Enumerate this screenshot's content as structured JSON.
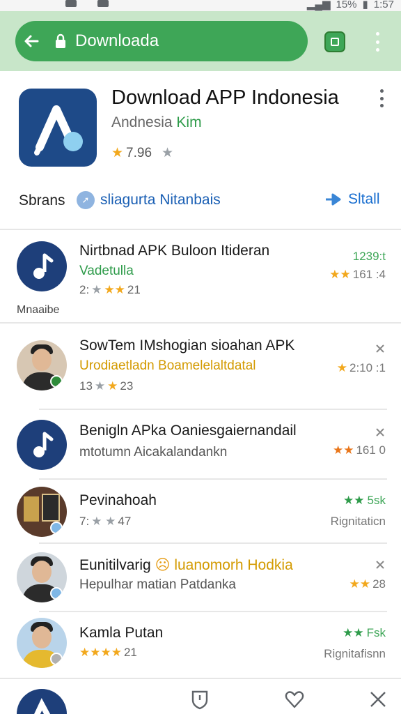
{
  "status": {
    "battery": "15%",
    "time": "1:57"
  },
  "browser": {
    "url": "Downloada"
  },
  "app": {
    "title": "Download APP Indonesia",
    "subtitle_main": "Andnesia",
    "subtitle_tag": "Kim",
    "rating": "7.96",
    "shares_label": "Sbrans",
    "share_link": "sliagurta  Nitanbais",
    "install_label": "Sltall"
  },
  "items": [
    {
      "title": "Nirtbnad APK Buloon Itideran",
      "subtitle": "Vadetulla",
      "meta": "2: ★ ★★ 21",
      "meta_prefix": "2:",
      "meta_count": "21",
      "right_top": "1239:t",
      "right_bottom": "161 :4",
      "footer": "Mnaaibe"
    },
    {
      "title": "SowTem IMshogian sioahan APK",
      "subtitle": "Urodiaetladn  Boamelelaltdatal",
      "meta_prefix": "13",
      "meta_count": "23",
      "right_bottom": "2:10 :1"
    },
    {
      "title": "Benigln APka Oaniesgaiernandail",
      "subtitle": "mtotumn Aicakalandankn",
      "right_bottom": "161 0"
    },
    {
      "title": "Pevinahoah",
      "meta_prefix": "7:",
      "meta_count": "47",
      "right_top": "5sk",
      "right_bottom": "Rignitaticn"
    },
    {
      "title": "Eunitilvarig",
      "title_tail": "luanomorh Hodkia",
      "subtitle": "Hepulhar matian Patdanka",
      "right_bottom": "28"
    },
    {
      "title": "Kamla Putan",
      "meta_count": "21",
      "right_top": "Fsk",
      "right_bottom": "Rignitafisnn"
    }
  ]
}
